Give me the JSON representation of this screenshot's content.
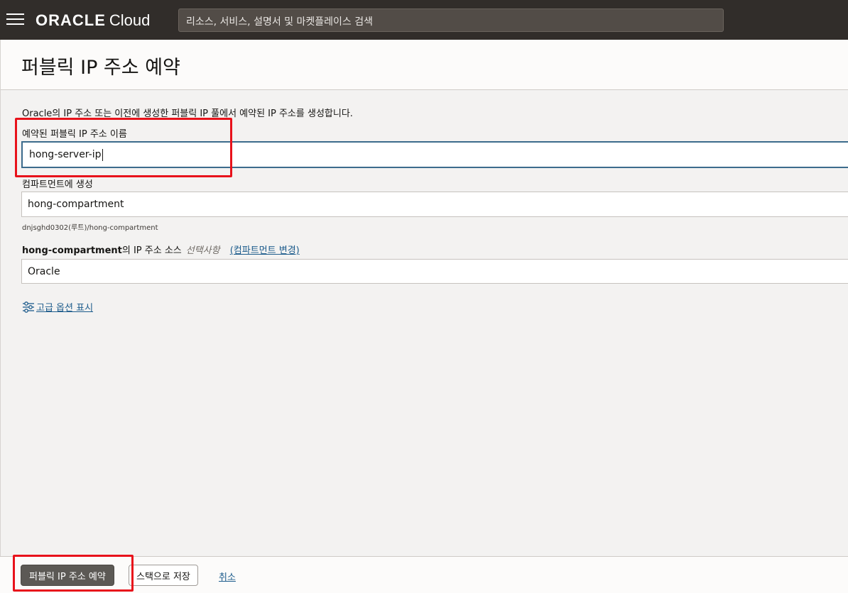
{
  "app": {
    "brand_oracle": "ORACLE",
    "brand_cloud": "Cloud",
    "search_placeholder": "리소스, 서비스, 설명서 및 마켓플레이스 검색"
  },
  "page": {
    "title": "퍼블릭 IP 주소 예약",
    "description": "Oracle의 IP 주소 또는 이전에 생성한 퍼블릭 IP 풀에서 예약된 IP 주소를 생성합니다."
  },
  "form": {
    "name_label": "예약된 퍼블릭 IP 주소 이름",
    "name_value": "hong-server-ip",
    "compartment_label": "컴파트먼트에 생성",
    "compartment_value": "hong-compartment",
    "compartment_path": "dnjsghd0302(루트)/hong-compartment",
    "source_compartment": "hong-compartment",
    "source_label_suffix": "의 IP 주소 소스",
    "source_optional": "선택사항",
    "change_compartment": "(컴파트먼트 변경)",
    "source_value": "Oracle",
    "advanced_options": "고급 옵션 표시"
  },
  "footer": {
    "primary_button": "퍼블릭 IP 주소 예약",
    "save_stack_button": "스택으로 저장",
    "cancel_link": "취소"
  },
  "colors": {
    "topbar": "#312d2a",
    "highlight": "#e8121b",
    "link": "#1d5c8c",
    "primary_button": "#5c5955"
  },
  "icons": {
    "menu": "hamburger-icon",
    "advanced": "sliders-icon"
  }
}
